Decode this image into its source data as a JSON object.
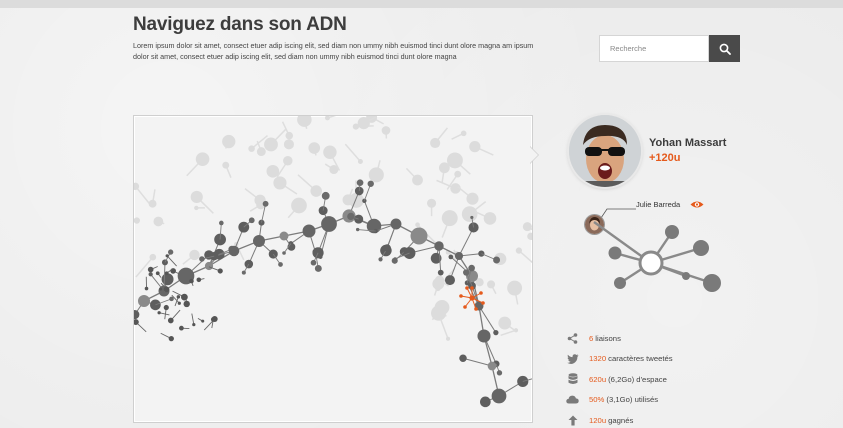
{
  "header": {
    "title": "Naviguez dans son ADN",
    "description": "Lorem ipsum dolor sit amet, consect etuer adip iscing elit, sed diam non ummy nibh euismod tinci dunt olore magna am ipsum dolor sit amet, consect etuer adip iscing elit, sed diam non ummy nibh euismod tinci dunt olore magna"
  },
  "search": {
    "placeholder": "Recherche",
    "icon": "search-icon"
  },
  "profile": {
    "name": "Yohan Massart",
    "points": "+120u"
  },
  "friend": {
    "name": "Julie Barreda",
    "icon": "eye-icon"
  },
  "stats": [
    {
      "icon": "share-icon",
      "value": "6",
      "label": "liaisons"
    },
    {
      "icon": "twitter-icon",
      "value": "1320",
      "label": "caractères tweetés"
    },
    {
      "icon": "database-icon",
      "value": "620u",
      "label": "(6,2Go) d'espace"
    },
    {
      "icon": "cloud-icon",
      "value": "50%",
      "label": "(3,1Go) utilisés"
    },
    {
      "icon": "arrow-up-icon",
      "value": "120u",
      "label": "gagnés"
    }
  ],
  "colors": {
    "accent": "#e55a1c",
    "dark": "#4a4a4a",
    "node": "#6e6e6e",
    "node_light": "#d9d9d9"
  }
}
